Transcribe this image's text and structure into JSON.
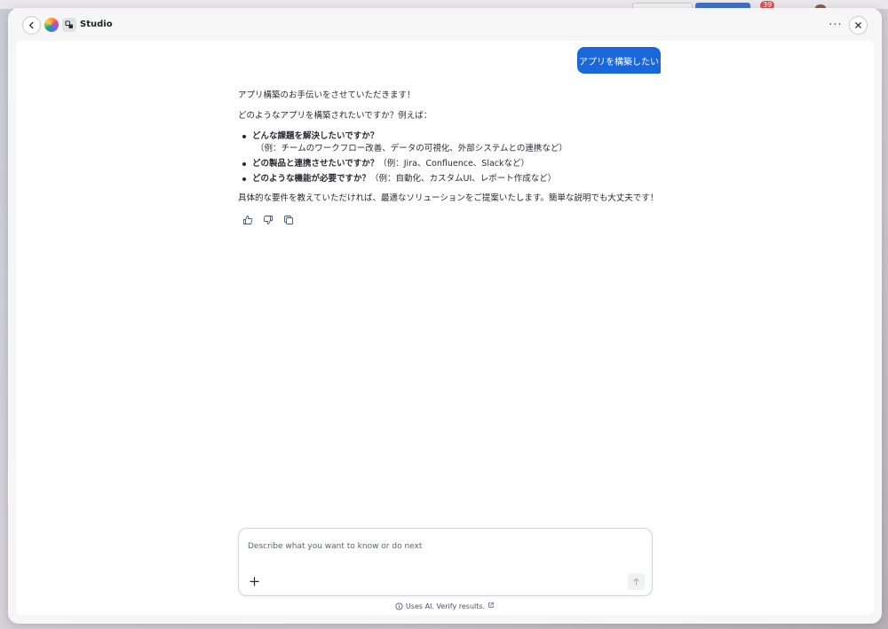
{
  "background": {
    "badge_count": "39"
  },
  "header": {
    "title": "Studio",
    "back_icon": "chevron-left-icon",
    "close_icon": "close-icon",
    "more_icon": "more-horizontal-icon",
    "more_glyph": "···"
  },
  "conversation": {
    "user_message": "アプリを構築したい",
    "assistant": {
      "intro": "アプリ構築のお手伝いをさせていただきます！",
      "question": "どのようなアプリを構築されたいですか？例えば：",
      "bullets": [
        {
          "bold": "どんな課題を解決したいですか？",
          "detail": "（例：チームのワークフロー改善、データの可視化、外部システムとの連携など）"
        },
        {
          "bold": "どの製品と連携させたいですか？",
          "detail": "（例：Jira、Confluence、Slackなど）"
        },
        {
          "bold": "どのような機能が必要ですか？",
          "detail": "（例：自動化、カスタムUI、レポート作成など）"
        }
      ],
      "closing": "具体的な要件を教えていただければ、最適なソリューションをご提案いたします。簡単な説明でも大丈夫です！"
    }
  },
  "feedback": {
    "like_icon": "thumbs-up-icon",
    "dislike_icon": "thumbs-down-icon",
    "copy_icon": "copy-icon"
  },
  "composer": {
    "placeholder": "Describe what you want to know or do next",
    "value": "",
    "plus_glyph": "+"
  },
  "disclaimer": {
    "text": "Uses AI. Verify results."
  },
  "colors": {
    "accent": "#1868db",
    "surface": "#ffffff",
    "modal_bg": "#f6f6f7"
  }
}
